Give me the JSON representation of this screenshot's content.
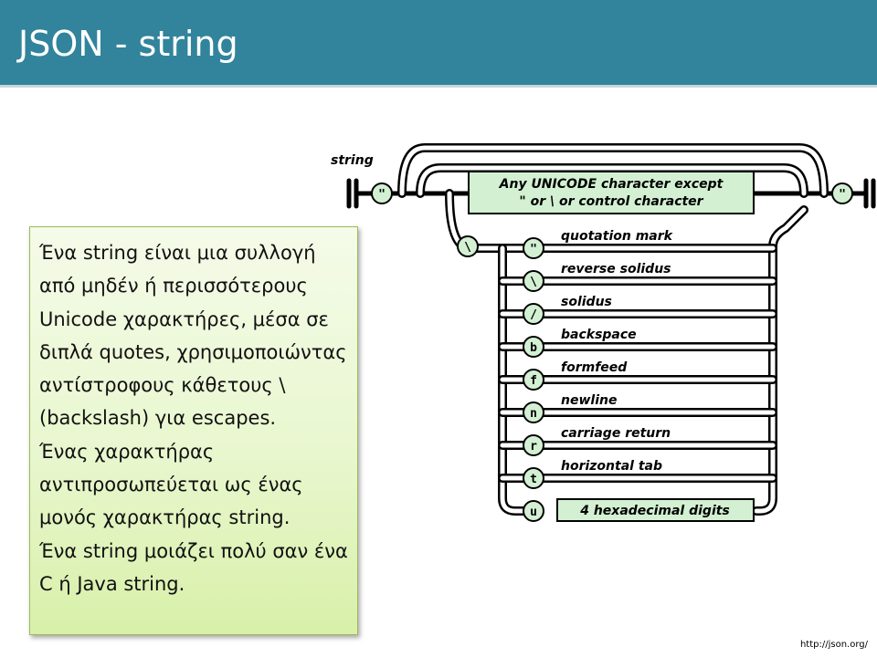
{
  "slide": {
    "title": "JSON - string",
    "source": "http://json.org/"
  },
  "textbox": {
    "paragraphs": [
      "Ένα string είναι μια συλλογή από μηδέν ή περισσότερους Unicode χαρακτήρες, μέσα σε διπλά quotes, χρησιμοποιώντας αντίστροφους κάθετους \\ (backslash) για escapes.",
      "Ένας χαρακτήρας αντιπροσωπεύεται ως ένας μονός χαρακτήρας string.",
      "Ένα string μοιάζει πολύ σαν ένα C ή Java string."
    ]
  },
  "diagram": {
    "name": "string",
    "open_quote": "\"",
    "close_quote": "\"",
    "backslash": "\\",
    "any_char_line1": "Any UNICODE character except",
    "any_char_line2": "\"  or  \\  or control character",
    "escapes": [
      {
        "symbol": "\"",
        "label": "quotation mark"
      },
      {
        "symbol": "\\",
        "label": "reverse solidus"
      },
      {
        "symbol": "/",
        "label": "solidus"
      },
      {
        "symbol": "b",
        "label": "backspace"
      },
      {
        "symbol": "f",
        "label": "formfeed"
      },
      {
        "symbol": "n",
        "label": "newline"
      },
      {
        "symbol": "r",
        "label": "carriage return"
      },
      {
        "symbol": "t",
        "label": "horizontal tab"
      },
      {
        "symbol": "u",
        "label": ""
      }
    ],
    "hex_box": "4 hexadecimal digits"
  }
}
